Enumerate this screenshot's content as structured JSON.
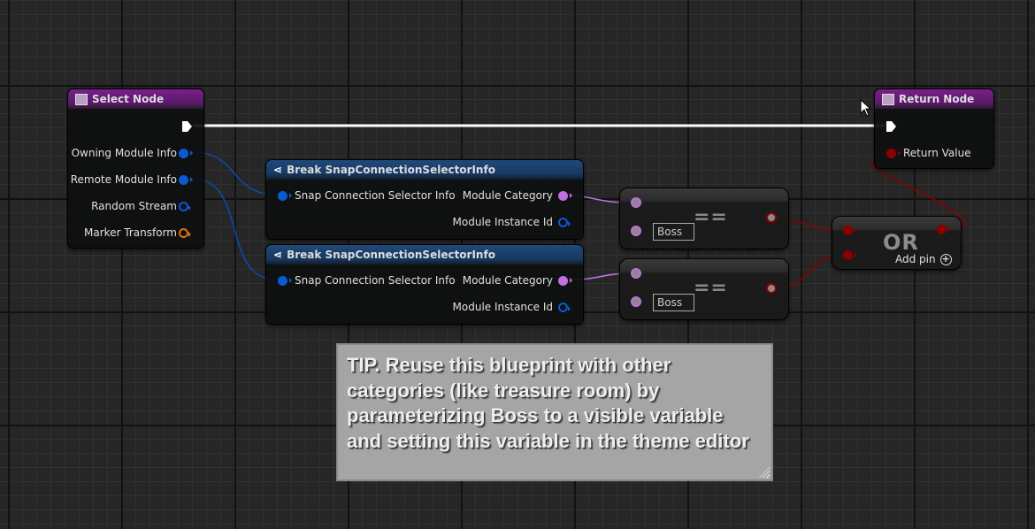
{
  "select_node": {
    "title": "Select Node",
    "icon": "function-icon",
    "pins": [
      "Owning Module Info",
      "Remote Module Info",
      "Random Stream",
      "Marker Transform"
    ]
  },
  "break_nodes": [
    {
      "title": "Break SnapConnectionSelectorInfo",
      "input": "Snap Connection Selector Info",
      "outputs": [
        "Module Category",
        "Module Instance Id"
      ]
    },
    {
      "title": "Break SnapConnectionSelectorInfo",
      "input": "Snap Connection Selector Info",
      "outputs": [
        "Module Category",
        "Module Instance Id"
      ]
    }
  ],
  "equal_nodes": [
    {
      "operator": "==",
      "value": "Boss"
    },
    {
      "operator": "==",
      "value": "Boss"
    }
  ],
  "or_node": {
    "operator": "OR",
    "add_pin": "Add pin"
  },
  "return_node": {
    "title": "Return Node",
    "pin": "Return Value"
  },
  "comment": {
    "text": "TIP. Reuse this blueprint with other categories (like treasure room) by parameterizing Boss to a visible variable and setting this variable in the theme editor"
  },
  "colors": {
    "struct_pin": "#0a5ad6",
    "byte_pin": "#c070e0",
    "bool_pin": "#8a0000",
    "transform_pin": "#e07010",
    "function_header": "#7a1f8c",
    "break_header": "#1f4a7a",
    "comment_bg": "#a5a5a5"
  }
}
